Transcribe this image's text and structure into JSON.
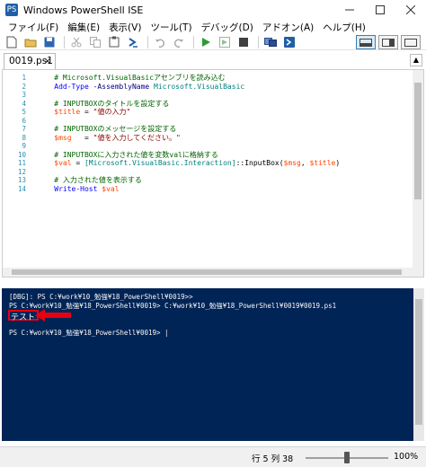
{
  "window": {
    "title": "Windows PowerShell ISE",
    "app_icon": "PS"
  },
  "menu": [
    "ファイル(F)",
    "編集(E)",
    "表示(V)",
    "ツール(T)",
    "デバッグ(D)",
    "アドオン(A)",
    "ヘルプ(H)"
  ],
  "toolbar": {
    "icons": [
      "new-file-icon",
      "open-folder-icon",
      "save-icon",
      "cut-icon",
      "copy-icon",
      "paste-icon",
      "powershell-icon",
      "undo-icon",
      "redo-icon",
      "run-icon",
      "run-selection-icon",
      "stop-icon",
      "remote-powershell-icon",
      "powershell-new-icon"
    ],
    "colors": {
      "run": "#2e9a35",
      "stop": "#404040",
      "ps": "#1f5fa8"
    }
  },
  "tabs": [
    {
      "label": "0019.ps1",
      "close": "×"
    }
  ],
  "collapse_label": "▲",
  "editor": {
    "lines": [
      [
        {
          "t": "    # Microsoft.VisualBasicアセンブリを読み込む",
          "c": "comment"
        }
      ],
      [
        {
          "t": "    Add-Type",
          "c": "cmd"
        },
        {
          "t": " -AssemblyName",
          "c": "param"
        },
        {
          "t": " Microsoft.VisualBasic",
          "c": "type"
        }
      ],
      [],
      [
        {
          "t": "    # INPUTBOXのタイトルを設定する",
          "c": "comment"
        }
      ],
      [
        {
          "t": "    $title",
          "c": "var"
        },
        {
          "t": " = ",
          "c": "plain"
        },
        {
          "t": "\"値の入力\"",
          "c": "str"
        }
      ],
      [],
      [
        {
          "t": "    # INPUTBOXのメッセージを設定する",
          "c": "comment"
        }
      ],
      [
        {
          "t": "    $msg",
          "c": "var"
        },
        {
          "t": "   = ",
          "c": "plain"
        },
        {
          "t": "\"値を入力してください。\"",
          "c": "str"
        }
      ],
      [],
      [
        {
          "t": "    # INPUTBOXに入力された値を変数valに格納する",
          "c": "comment"
        }
      ],
      [
        {
          "t": "    $val",
          "c": "var"
        },
        {
          "t": " = ",
          "c": "plain"
        },
        {
          "t": "[Microsoft.VisualBasic.Interaction]",
          "c": "type"
        },
        {
          "t": "::InputBox(",
          "c": "plain"
        },
        {
          "t": "$msg",
          "c": "var"
        },
        {
          "t": ", ",
          "c": "plain"
        },
        {
          "t": "$title",
          "c": "var"
        },
        {
          "t": ")",
          "c": "plain"
        }
      ],
      [],
      [
        {
          "t": "    # 入力された値を表示する",
          "c": "comment"
        }
      ],
      [
        {
          "t": "    Write-Host",
          "c": "cmd"
        },
        {
          "t": " $val",
          "c": "var"
        }
      ]
    ]
  },
  "console": {
    "lines": [
      "[DBG]: PS C:¥work¥10_勉強¥18_PowerShell¥0019>>",
      "PS C:¥work¥10_勉強¥18_PowerShell¥0019> C:¥work¥10_勉強¥18_PowerShell¥0019¥0019.ps1",
      "",
      "",
      "PS C:¥work¥10_勉強¥18_PowerShell¥0019> |"
    ],
    "output_text": "テスト",
    "highlight_color": "#e60012",
    "background": "#012456"
  },
  "status": {
    "position": "行 5  列 38",
    "zoom": "100%",
    "zoom_level": 0.5
  }
}
